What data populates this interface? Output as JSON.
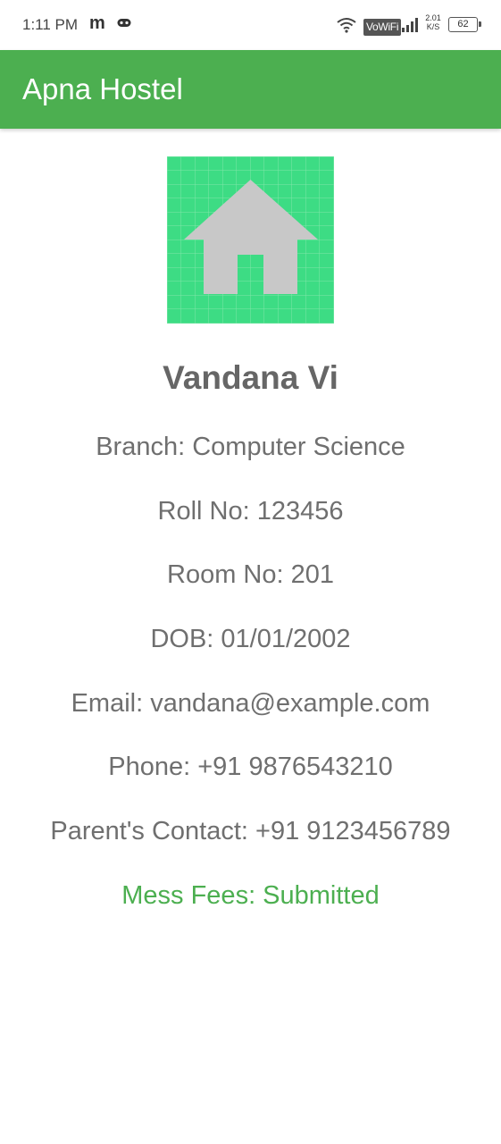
{
  "status_bar": {
    "time": "1:11 PM",
    "carrier_icon": "m",
    "vowifi": "VoWiFi",
    "speed_value": "2.01",
    "speed_unit": "K/S",
    "battery": "62"
  },
  "app_bar": {
    "title": "Apna Hostel",
    "color": "#4caf50"
  },
  "profile": {
    "avatar_icon": "house-icon",
    "name": "Vandana Vi",
    "branch": "Branch: Computer Science",
    "roll_no": "Roll No: 123456",
    "room_no": "Room No: 201",
    "dob": "DOB: 01/01/2002",
    "email": "Email: vandana@example.com",
    "phone": "Phone: +91 9876543210",
    "parent_contact": "Parent's Contact: +91 9123456789",
    "mess_fees": "Mess Fees: Submitted",
    "fees_color": "#4caf50"
  }
}
